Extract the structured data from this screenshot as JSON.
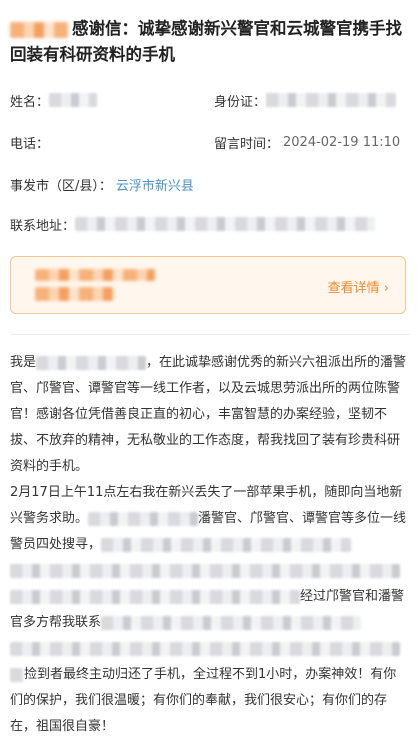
{
  "header": {
    "title": "感谢信：诚挚感谢新兴警官和云城警官携手找回装有科研资料的手机"
  },
  "fields": {
    "name_label": "姓名：",
    "id_label": "身份证：",
    "phone_label": "电话：",
    "time_label": "留言时间：",
    "time_value": "2024-02-19 11:10",
    "location_label": "事发市（区/县）：",
    "location_value": "云浮市新兴县",
    "address_label": "联系地址："
  },
  "card": {
    "detail_label": "查看详情 ›",
    "accent": "#f08a2a"
  },
  "content": {
    "p1a": "我是",
    "p1b": "，在此诚挚感谢优秀的新兴六祖派出所的潘警官、邝警官、谭警官等一线工作者，以及云城思劳派出所的两位陈警官！感谢各位凭借善良正直的初心，丰富智慧的办案经验，坚韧不拔、不放弃的精神，无私敬业的工作态度，帮我找回了装有珍贵科研资料的手机。",
    "p2a": "2月17日上午11点左右我在新兴丢失了一部苹果手机，随即向当地新兴警务求助。",
    "p2b": "潘警官、邝警官、谭警官等多位一线警员四处搜寻，",
    "p2c": "经过邝警官和潘警官多方帮我联系",
    "p2d": "捡到者最终主动归还了手机，全过程不到1小时，办案神效！有你们的保护，我们很温暖；有你们的奉献，我们很安心；有你们的存在，祖国很自豪！"
  }
}
